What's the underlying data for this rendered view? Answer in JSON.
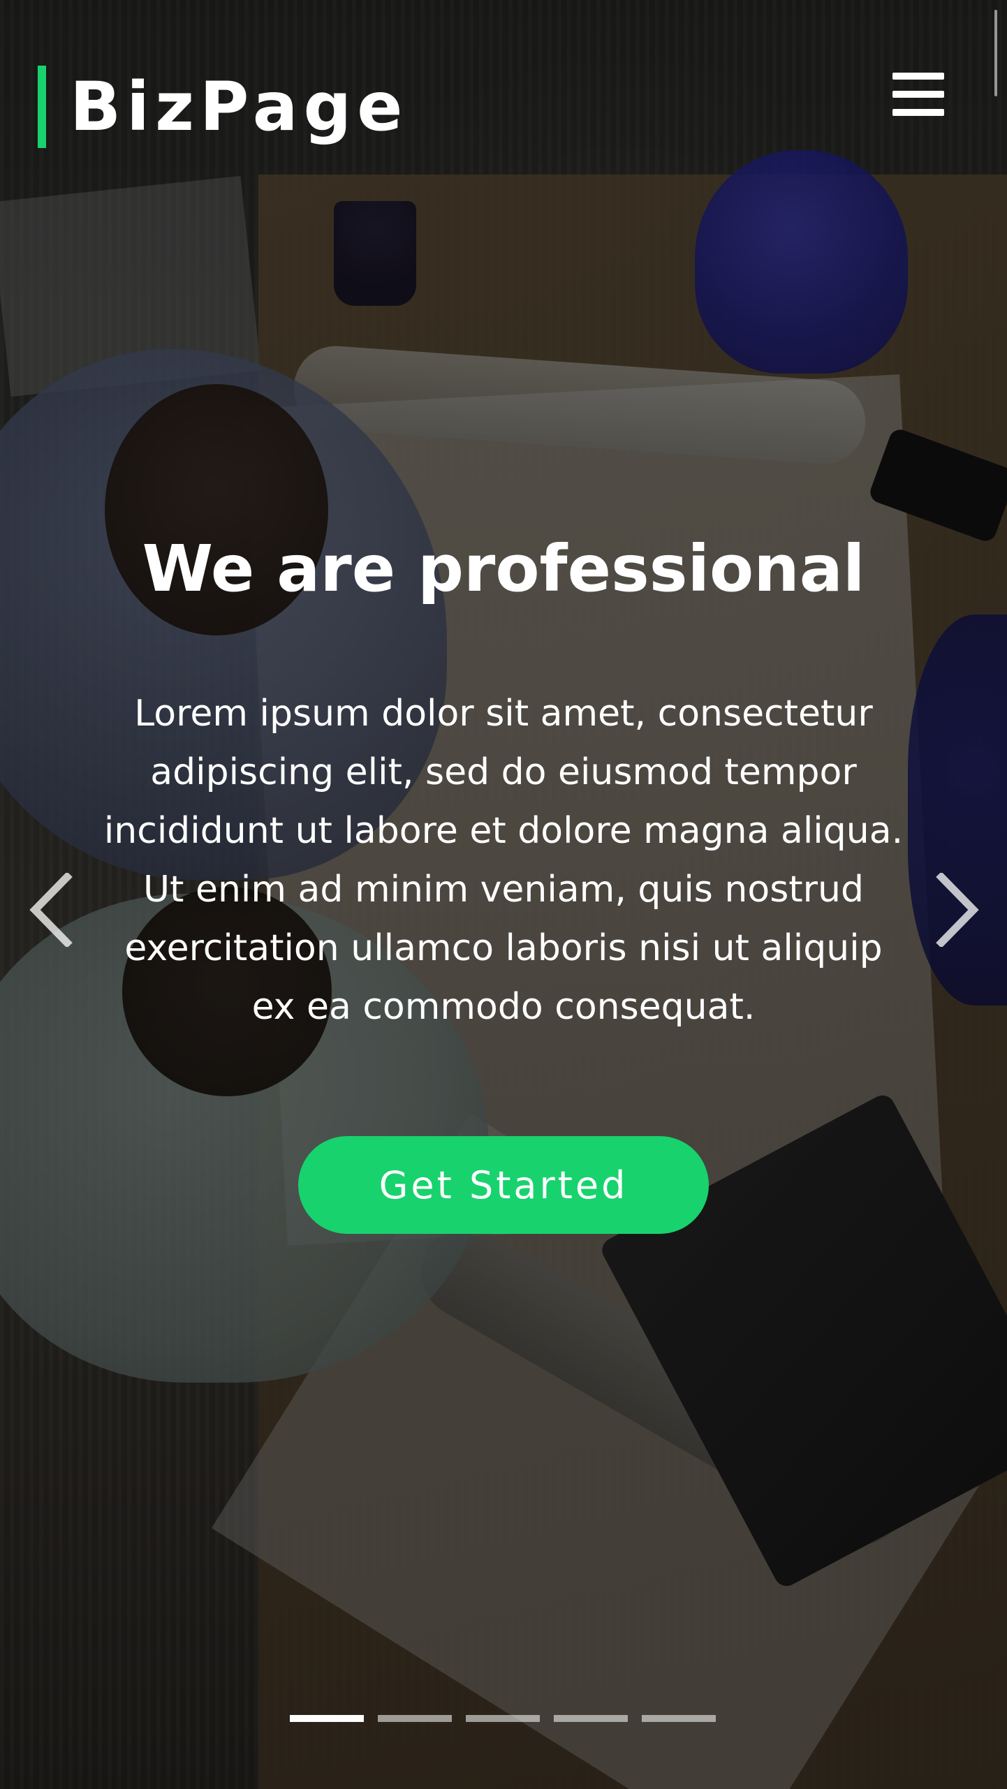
{
  "header": {
    "logo_text": "BizPage",
    "menu_icon": "hamburger-menu-icon"
  },
  "hero": {
    "title": "We are professional",
    "description": "Lorem ipsum dolor sit amet, consectetur adipiscing elit, sed do eiusmod tempor incididunt ut labore et dolore magna aliqua. Ut enim ad minim veniam, quis nostrud exercitation ullamco laboris nisi ut aliquip ex ea commodo consequat.",
    "cta_label": "Get Started"
  },
  "carousel": {
    "prev_icon": "chevron-left-icon",
    "next_icon": "chevron-right-icon",
    "slide_count": 5,
    "active_slide": 1
  },
  "colors": {
    "accent": "#18d26e",
    "text": "#ffffff",
    "indicator_inactive": "rgba(255,255,255,0.55)"
  }
}
